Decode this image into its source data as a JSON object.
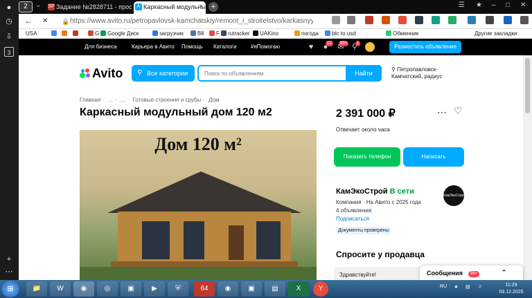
{
  "browser": {
    "tab_count": "2",
    "tabs": [
      {
        "label": "Задание №2828711 - прос",
        "favicon": "SP",
        "active": false
      },
      {
        "label": "Каркасный модульный",
        "favicon": "A",
        "active": true
      }
    ],
    "address": "https://www.avito.ru/petropavlovsk-kamchatskiy/remont_i_stroitelstvo/karkasnyy...",
    "bookmarks": [
      "USA",
      "G",
      "Google Диск",
      "загрузчик",
      "ВК",
      "F",
      "rutracker",
      "UAKino",
      "погода",
      "btc to usd",
      "Обменник",
      "Другие закладки"
    ],
    "side_counter": "3"
  },
  "avito_header": {
    "links": [
      "Для бизнеса",
      "Карьера в Авито",
      "Помощь",
      "Каталоги",
      "#яПомогаю"
    ],
    "notif_badge": "12",
    "msg_badge": "99+",
    "cart_badge": "1",
    "post_button": "Разместить объявление"
  },
  "search": {
    "logo": "Avito",
    "categories_button": "Все категории",
    "placeholder": "Поиск по объявлениям",
    "button": "Найти",
    "location": "Петропавловск-Камчатский, радиус"
  },
  "listing": {
    "breadcrumbs": [
      "Главная",
      "...",
      "...",
      "Готовые строения и срубы",
      "Дом"
    ],
    "title": "Каркасный модульный дом 120 м2",
    "photo_text": "Дом 120 м²",
    "price": "2 391 000 ₽",
    "response": "Отвечает около часа",
    "phone_button": "Показать телефон",
    "write_button": "Написать"
  },
  "seller": {
    "name": "КамЭкоСтрой",
    "status": "В сети",
    "type_line": "Компания · На Авито с 2025 года",
    "ads": "4 объявления",
    "subscribe": "Подписаться",
    "verified": "Документы проверены",
    "avatar_text": "КамЭкоСтрой"
  },
  "ask": {
    "heading": "Спросите у продавца",
    "suggestion": "Здравствуйте!"
  },
  "messages_popup": {
    "label": "Сообщения",
    "badge": "99+"
  },
  "taskbar": {
    "lang": "RU",
    "time": "11:29",
    "date": "03.12.2025",
    "app_64": "64"
  },
  "colors": {
    "accent": "#00aaff",
    "green": "#00c65a",
    "badge": "#ff4053"
  }
}
